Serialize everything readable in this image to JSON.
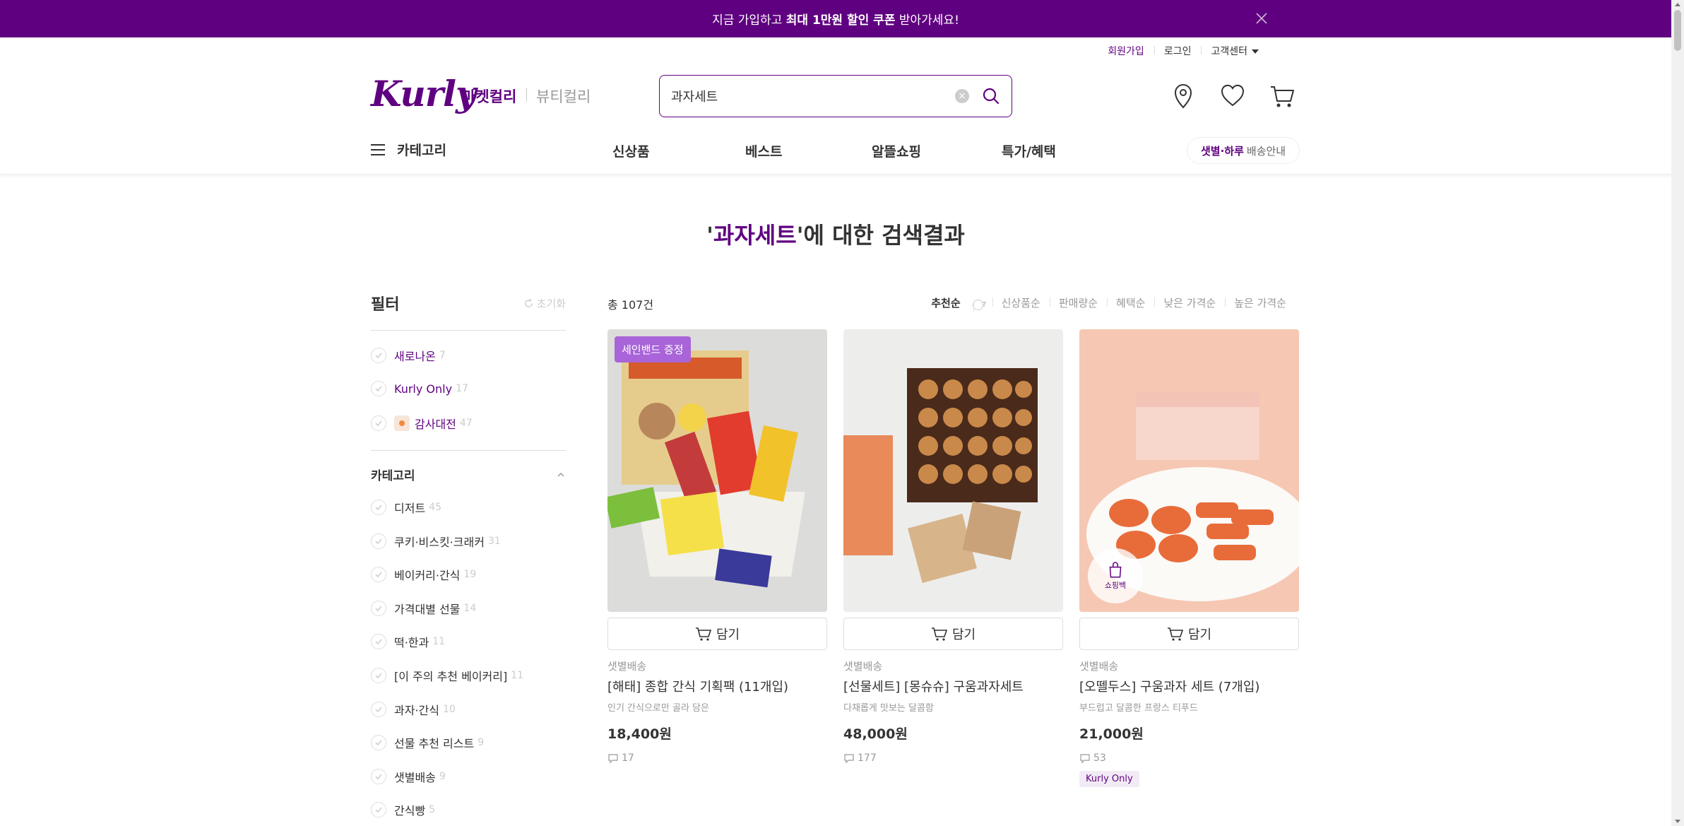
{
  "banner": {
    "text_pre": "지금 가입하고 ",
    "text_bold": "최대 1만원 할인 쿠폰",
    "text_post": " 받아가세요!"
  },
  "util": {
    "signup": "회원가입",
    "login": "로그인",
    "cs": "고객센터"
  },
  "header": {
    "logo": "Kurly",
    "market_tab": "마켓컬리",
    "beauty_tab": "뷰티컬리",
    "search_value": "과자세트"
  },
  "gnb": {
    "category": "카테고리",
    "menus": [
      "신상품",
      "베스트",
      "알뜰쇼핑",
      "특가/혜택"
    ],
    "delivery_bold": "샛별·하루",
    "delivery_text": "배송안내"
  },
  "result": {
    "keyword": "과자세트",
    "suffix": "에 대한 검색결과",
    "quote": "'"
  },
  "filter": {
    "title": "필터",
    "reset": "초기화",
    "quick": [
      {
        "label": "새로나온",
        "count": "7"
      },
      {
        "label": "Kurly Only",
        "count": "17"
      },
      {
        "label": "감사대전",
        "count": "47"
      }
    ],
    "category_title": "카테고리",
    "categories": [
      {
        "label": "디저트",
        "count": "45"
      },
      {
        "label": "쿠키·비스킷·크래커",
        "count": "31"
      },
      {
        "label": "베이커리·간식",
        "count": "19"
      },
      {
        "label": "가격대별 선물",
        "count": "14"
      },
      {
        "label": "떡·한과",
        "count": "11"
      },
      {
        "label": "[이 주의 추천 베이커리]",
        "count": "11"
      },
      {
        "label": "과자·간식",
        "count": "10"
      },
      {
        "label": "선물 추천 리스트",
        "count": "9"
      },
      {
        "label": "샛별배송",
        "count": "9"
      },
      {
        "label": "간식빵",
        "count": "5"
      }
    ]
  },
  "list": {
    "total": "총 107건",
    "sorts": [
      "추천순",
      "신상품순",
      "판매량순",
      "혜택순",
      "낮은 가격순",
      "높은 가격순"
    ],
    "help": "?"
  },
  "products": [
    {
      "badge": "세인밴드 증정",
      "cart": "담기",
      "ship": "샛별배송",
      "name": "[해태] 종합 간식 기획팩 (11개입)",
      "desc": "인기 간식으로만 골라 담은",
      "price": "18,400원",
      "reviews": "17",
      "tag": ""
    },
    {
      "badge": "",
      "cart": "담기",
      "ship": "샛별배송",
      "name": "[선물세트] [몽슈슈] 구움과자세트",
      "desc": "다채롭게 맛보는 달콤함",
      "price": "48,000원",
      "reviews": "177",
      "tag": ""
    },
    {
      "badge": "",
      "cart": "담기",
      "ship": "샛별배송",
      "name": "[오뗄두스] 구움과자 세트 (7개입)",
      "desc": "부드럽고 달콤한 프랑스 티푸드",
      "price": "21,000원",
      "reviews": "53",
      "tag": "Kurly Only",
      "bag_label": "쇼핑백"
    }
  ],
  "colors": {
    "brand": "#5f0080",
    "badge": "#a864d8"
  }
}
